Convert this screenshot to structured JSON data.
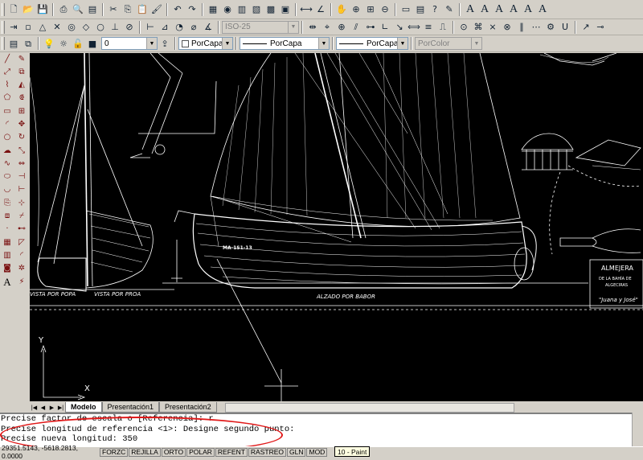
{
  "toolbar": {
    "dimstyle": "ISO-25",
    "layer": "0",
    "color": "PorCapa",
    "linetype": "PorCapa",
    "lineweight": "PorCapa",
    "plotstyle": "PorColor"
  },
  "drawing": {
    "label_popa": "VISTA POR POPA",
    "label_proa": "VISTA POR PROA",
    "label_babor": "ALZADO POR BABOR",
    "hull_mark": "MA-1S1-13",
    "title_1": "ALMEJERA",
    "title_2": "DE LA BAHÍA DE",
    "title_3": "ALGECIRAS",
    "title_4": "\"Juana y José\"",
    "ucs_x": "X",
    "ucs_y": "Y"
  },
  "tabs": {
    "model": "Modelo",
    "layout1": "Presentación1",
    "layout2": "Presentación2"
  },
  "command": {
    "line1": "Precise factor de escala o [Referencia]: r",
    "line2": "Precise longitud de referencia <1>:  Designe segundo punto:",
    "line3": "Precise nueva longitud: 350"
  },
  "status": {
    "coords": "29351.5143, -5618.2813, 0.0000",
    "snap": "FORZC",
    "grid": "REJILLA",
    "ortho": "ORTO",
    "polar": "POLAR",
    "osnap": "REFENT",
    "otrack": "RASTREO",
    "lwt": "GLN",
    "model": "MOD",
    "tooltip": "10 - Paint"
  },
  "colors": {
    "canvas_bg": "#000000",
    "drawing_line": "#ffffff",
    "highlight": "#e01818",
    "toolbar_bg": "#d4d0c8"
  }
}
